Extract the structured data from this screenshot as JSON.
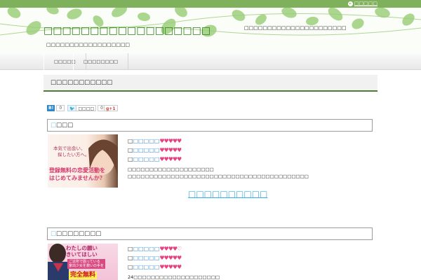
{
  "header": {
    "top_link": "□□□□□",
    "site_title": "□□□□□□□□□□□□□□□□□□",
    "site_description": "□□□□□□□□□□□□□□□□□□",
    "message": "□□□□□□□□□□□□□□□□□□□□□□",
    "colors": {
      "topbar": "#7fb05b",
      "title": "#2e7d1b"
    }
  },
  "nav": {
    "items": [
      {
        "label": "□□□□□"
      },
      {
        "label": "□□□□□□□□"
      }
    ]
  },
  "page": {
    "title": "□□□□□□□□□□□",
    "share": [
      {
        "icon": "hatena-bookmark-icon",
        "badge": "B!",
        "count": "0"
      },
      {
        "icon": "twitter-icon",
        "badge": "□□□□",
        "count": "0"
      },
      {
        "icon": "google-plus-icon",
        "badge": "g+1",
        "count": ""
      }
    ]
  },
  "sections": [
    {
      "heading_prefix": "□",
      "heading": "□□□",
      "thumb_lines": [
        "本気で出会い、",
        "探したい方へ。",
        "登録無料の恋愛活動を",
        "はじめてみませんか？"
      ],
      "ratings": [
        {
          "label": "□□□□□",
          "hearts": "♥♥♥♥♥"
        },
        {
          "label": "□□□□□",
          "hearts": "♥♥♥♥♥"
        },
        {
          "label": "□□□□□",
          "hearts": "♥♥♥♥♥"
        }
      ],
      "desc": [
        "□□□□□□□□□□□□□□□□□□□□",
        "□□□□□□□□□□□□□□□□□□□□□□□□□□□□□□□□□□□□□□□□□□"
      ],
      "cta": "□□□□□□□□□□"
    },
    {
      "heading_prefix": "□",
      "heading": "□□□□□□□□",
      "thumb_lines": [
        "わたしの願い",
        "きいてほしい",
        "ご近所で困っている",
        "家出少女を救いの手を",
        "完全無料"
      ],
      "ratings": [
        {
          "label": "□□□□□",
          "hearts": "♥♥♥♥♡"
        },
        {
          "label": "□□□□□",
          "hearts": "♥♥♥♥♥"
        },
        {
          "label": "□□□□□",
          "hearts": "♥♥♥♥♥"
        }
      ],
      "desc": [
        "24□□□□□□□□□□□□□□□□□□□□"
      ]
    }
  ]
}
